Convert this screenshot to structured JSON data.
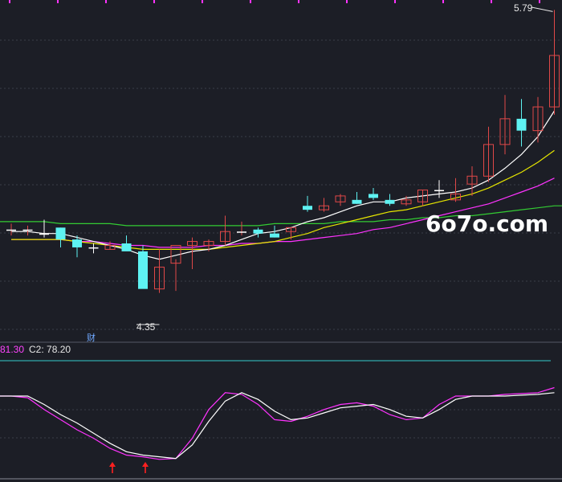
{
  "watermark": "6o7o.com",
  "indicator": {
    "c1_value": "81.30",
    "c2_label": "C2:",
    "c2_value": "78.20"
  },
  "high_label": "5.79",
  "low_label": "4.35",
  "fin_badge": "财",
  "colors": {
    "background": "#1c1e26",
    "up": "#e04848",
    "down": "#5ef2f2",
    "ma_fast": "#ffffff",
    "ma_mid": "#e6e600",
    "ma_slow": "#ff33ff",
    "ma_long": "#33cc33",
    "indicator_c1": "#ff33ff",
    "indicator_c2": "#ffffff",
    "threshold": "#33cccc",
    "arrow": "#ff2020",
    "grid": "#3a3d48",
    "top_ticks": "#ff33ff"
  },
  "chart_data": [
    {
      "type": "candlestick",
      "ylim": [
        4.2,
        5.82
      ],
      "x": [
        1,
        2,
        3,
        4,
        5,
        6,
        7,
        8,
        9,
        10,
        11,
        12,
        13,
        14,
        15,
        16,
        17,
        18,
        19,
        20,
        21,
        22,
        23,
        24,
        25,
        26,
        27,
        28,
        29,
        30,
        31,
        32,
        33,
        34
      ],
      "open": [
        4.68,
        4.68,
        4.66,
        4.69,
        4.63,
        4.59,
        4.58,
        4.61,
        4.57,
        4.38,
        4.51,
        4.6,
        4.6,
        4.62,
        4.66,
        4.68,
        4.66,
        4.67,
        4.8,
        4.78,
        4.82,
        4.83,
        4.86,
        4.83,
        4.81,
        4.82,
        4.88,
        4.83,
        4.91,
        4.95,
        5.11,
        5.24,
        5.18,
        5.3
      ],
      "high": [
        4.71,
        4.7,
        4.73,
        4.69,
        4.65,
        4.61,
        4.62,
        4.65,
        4.6,
        4.58,
        4.53,
        4.64,
        4.63,
        4.75,
        4.72,
        4.69,
        4.7,
        4.69,
        4.85,
        4.84,
        4.86,
        4.87,
        4.89,
        4.86,
        4.85,
        4.88,
        4.93,
        4.94,
        5.0,
        5.2,
        5.36,
        5.34,
        5.35,
        5.79
      ],
      "low": [
        4.65,
        4.65,
        4.64,
        4.59,
        4.54,
        4.56,
        4.58,
        4.59,
        4.53,
        4.36,
        4.37,
        4.48,
        4.57,
        4.6,
        4.65,
        4.64,
        4.64,
        4.63,
        4.77,
        4.77,
        4.8,
        4.81,
        4.83,
        4.8,
        4.8,
        4.8,
        4.84,
        4.82,
        4.85,
        4.92,
        5.06,
        5.1,
        5.12,
        5.26
      ],
      "close": [
        4.68,
        4.68,
        4.65,
        4.63,
        4.59,
        4.58,
        4.6,
        4.57,
        4.38,
        4.49,
        4.6,
        4.62,
        4.62,
        4.67,
        4.67,
        4.66,
        4.64,
        4.69,
        4.78,
        4.8,
        4.85,
        4.81,
        4.84,
        4.81,
        4.83,
        4.88,
        4.87,
        4.86,
        4.95,
        5.11,
        5.24,
        5.18,
        5.3,
        5.56
      ],
      "ma_fast": [
        4.67,
        4.67,
        4.66,
        4.66,
        4.64,
        4.62,
        4.6,
        4.58,
        4.55,
        4.53,
        4.55,
        4.57,
        4.58,
        4.6,
        4.63,
        4.66,
        4.67,
        4.69,
        4.72,
        4.74,
        4.77,
        4.8,
        4.82,
        4.82,
        4.84,
        4.85,
        4.86,
        4.87,
        4.89,
        4.93,
        4.99,
        5.06,
        5.15,
        5.28
      ],
      "ma_mid": [
        4.63,
        4.63,
        4.63,
        4.63,
        4.62,
        4.61,
        4.6,
        4.59,
        4.58,
        4.58,
        4.58,
        4.58,
        4.58,
        4.59,
        4.6,
        4.61,
        4.62,
        4.64,
        4.66,
        4.69,
        4.71,
        4.73,
        4.75,
        4.77,
        4.78,
        4.8,
        4.82,
        4.84,
        4.86,
        4.89,
        4.93,
        4.97,
        5.02,
        5.08
      ],
      "ma_slow": [
        4.63,
        4.63,
        4.63,
        4.63,
        4.62,
        4.62,
        4.61,
        4.6,
        4.6,
        4.59,
        4.59,
        4.59,
        4.6,
        4.6,
        4.61,
        4.61,
        4.62,
        4.62,
        4.63,
        4.64,
        4.65,
        4.66,
        4.68,
        4.69,
        4.71,
        4.73,
        4.75,
        4.77,
        4.79,
        4.81,
        4.84,
        4.87,
        4.9,
        4.94
      ],
      "ma_long": [
        4.72,
        4.72,
        4.72,
        4.71,
        4.71,
        4.71,
        4.71,
        4.7,
        4.7,
        4.7,
        4.7,
        4.7,
        4.7,
        4.7,
        4.7,
        4.7,
        4.71,
        4.71,
        4.71,
        4.71,
        4.72,
        4.72,
        4.72,
        4.73,
        4.73,
        4.74,
        4.74,
        4.75,
        4.75,
        4.76,
        4.77,
        4.78,
        4.79,
        4.8
      ],
      "annotations": [
        {
          "text": "5.79",
          "x": 34,
          "y": 5.79
        },
        {
          "text": "4.35",
          "x": 10,
          "y": 4.36
        },
        {
          "text": "财",
          "x": 7
        }
      ]
    },
    {
      "type": "line",
      "ylim": [
        0,
        100
      ],
      "x": [
        1,
        2,
        3,
        4,
        5,
        6,
        7,
        8,
        9,
        10,
        11,
        12,
        13,
        14,
        15,
        16,
        17,
        18,
        19,
        20,
        21,
        22,
        23,
        24,
        25,
        26,
        27,
        28,
        29,
        30,
        31,
        32,
        33,
        34
      ],
      "series": [
        {
          "name": "C1",
          "values": [
            80,
            78,
            64,
            52,
            40,
            30,
            18,
            10,
            8,
            5,
            6,
            30,
            64,
            84,
            82,
            70,
            52,
            50,
            56,
            64,
            70,
            72,
            68,
            58,
            52,
            54,
            70,
            80,
            80,
            80,
            82,
            83,
            84,
            90
          ]
        },
        {
          "name": "C2",
          "values": [
            80,
            80,
            70,
            58,
            48,
            36,
            24,
            14,
            10,
            8,
            6,
            22,
            50,
            74,
            84,
            76,
            62,
            52,
            54,
            60,
            66,
            68,
            70,
            64,
            56,
            54,
            64,
            76,
            80,
            80,
            80,
            81,
            82,
            84
          ]
        }
      ],
      "threshold": 88,
      "arrows_at": [
        7,
        9
      ]
    }
  ]
}
